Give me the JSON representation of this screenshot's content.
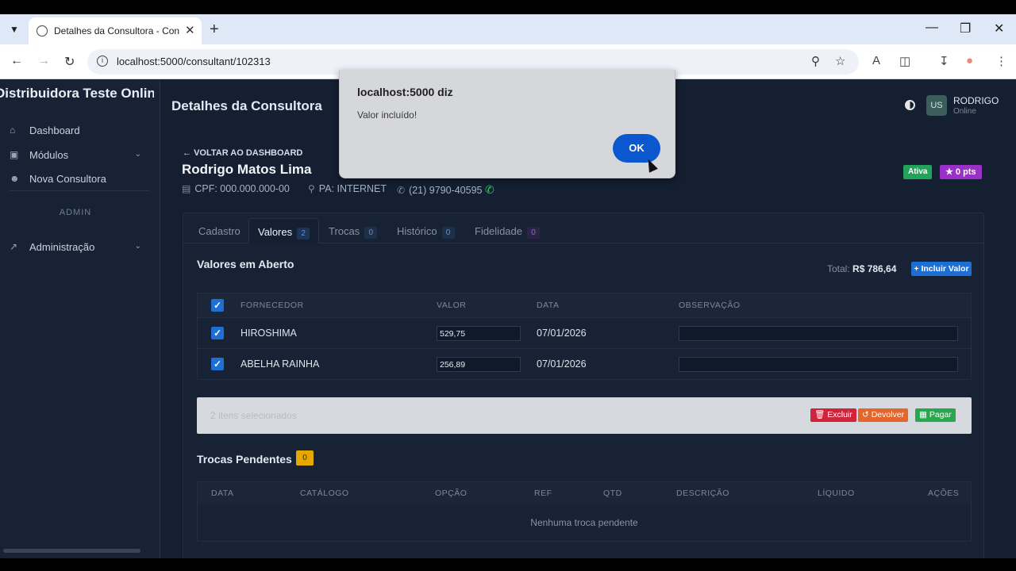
{
  "browser": {
    "tab_title": "Detalhes da Consultora - Consu",
    "url": "localhost:5000/consultant/102313"
  },
  "sidebar": {
    "brand": "Distribuidora Teste Online",
    "items": [
      {
        "label": "Dashboard",
        "icon": "home-icon"
      },
      {
        "label": "Módulos",
        "icon": "modules-icon"
      },
      {
        "label": "Nova Consultora",
        "icon": "user-plus-icon"
      }
    ],
    "section_label": "ADMIN",
    "admin_items": [
      {
        "label": "Administração",
        "icon": "chart-icon"
      }
    ]
  },
  "header": {
    "title": "Detalhes da Consultora",
    "avatar": "US",
    "user_name": "RODRIGO",
    "user_status": "Online"
  },
  "consultant": {
    "back_link": "VOLTAR AO DASHBOARD",
    "name": "Rodrigo Matos Lima",
    "cpf": "CPF: 000.000.000-00",
    "pa": "PA: INTERNET",
    "phone": "(21) 9790-40595",
    "status_badge": "Ativa",
    "points": "0 pts"
  },
  "tabs": [
    {
      "label": "Cadastro",
      "count": null
    },
    {
      "label": "Valores",
      "count": "2"
    },
    {
      "label": "Trocas",
      "count": "0"
    },
    {
      "label": "Histórico",
      "count": "0"
    },
    {
      "label": "Fidelidade",
      "count": "0"
    }
  ],
  "valores": {
    "title": "Valores em Aberto",
    "total_label": "Total:",
    "total_value": "R$ 786,64",
    "add_button": "+ Incluir Valor",
    "columns": [
      "FORNECEDOR",
      "VALOR",
      "DATA",
      "OBSERVAÇÃO"
    ],
    "rows": [
      {
        "fornecedor": "HIROSHIMA",
        "valor": "529,75",
        "data": "07/01/2026",
        "obs": ""
      },
      {
        "fornecedor": "ABELHA RAINHA",
        "valor": "256,89",
        "data": "07/01/2026",
        "obs": ""
      }
    ],
    "selected_text": "2 itens selecionados",
    "actions": {
      "excluir": "Excluir",
      "devolver": "Devolver",
      "pagar": "Pagar"
    }
  },
  "trocas": {
    "title": "Trocas Pendentes",
    "count": "0",
    "columns": [
      "DATA",
      "CATÁLOGO",
      "OPÇÃO",
      "REF",
      "QTD",
      "DESCRIÇÃO",
      "LÍQUIDO",
      "AÇÕES"
    ],
    "empty": "Nenhuma troca pendente"
  },
  "dialog": {
    "title": "localhost:5000 diz",
    "message": "Valor incluído!",
    "ok": "OK"
  },
  "colors": {
    "background": "#141f31",
    "accent": "#1f6ed4",
    "success": "#22a35a",
    "danger": "#d1243c",
    "warning": "#e4662a",
    "points": "#9b30c9"
  }
}
